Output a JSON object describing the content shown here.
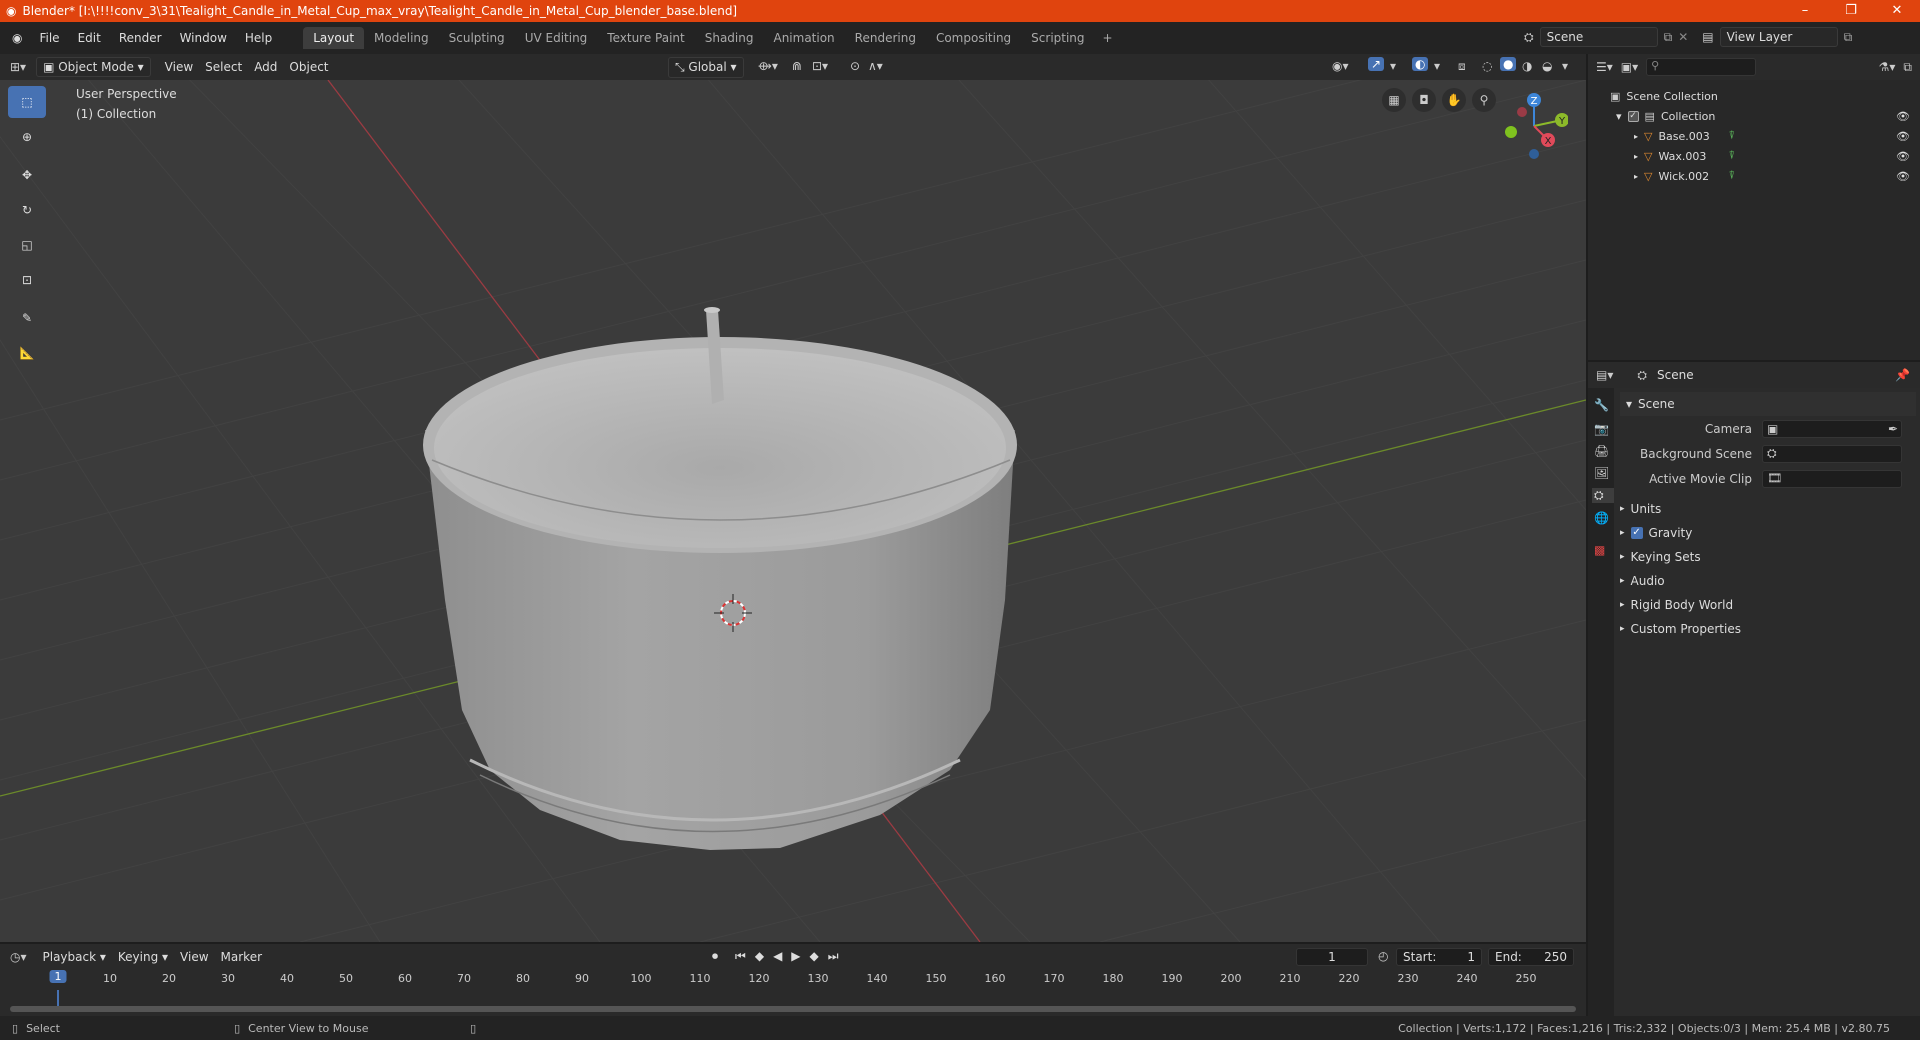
{
  "window": {
    "title": "Blender* [I:\\!!!!conv_3\\31\\Tealight_Candle_in_Metal_Cup_max_vray\\Tealight_Candle_in_Metal_Cup_blender_base.blend]"
  },
  "menu": {
    "items": [
      "File",
      "Edit",
      "Render",
      "Window",
      "Help"
    ]
  },
  "workspaces": {
    "tabs": [
      "Layout",
      "Modeling",
      "Sculpting",
      "UV Editing",
      "Texture Paint",
      "Shading",
      "Animation",
      "Rendering",
      "Compositing",
      "Scripting"
    ]
  },
  "scene_selector": {
    "scene": "Scene",
    "view_layer": "View Layer"
  },
  "viewport_header": {
    "mode": "Object Mode",
    "view": "View",
    "select": "Select",
    "add": "Add",
    "object": "Object",
    "transform": "Global"
  },
  "viewport": {
    "perspective": "User Perspective",
    "collection": "(1) Collection"
  },
  "gizmo": {
    "z": "Z",
    "y": "Y",
    "x": "X"
  },
  "outliner": {
    "root": "Scene Collection",
    "collection": "Collection",
    "objects": [
      "Base.003",
      "Wax.003",
      "Wick.002"
    ]
  },
  "properties": {
    "header": "Scene",
    "panel": "Scene",
    "fields": {
      "camera": "Camera",
      "background_scene": "Background Scene",
      "active_movie_clip": "Active Movie Clip"
    },
    "sections": [
      "Units",
      "Gravity",
      "Keying Sets",
      "Audio",
      "Rigid Body World",
      "Custom Properties"
    ]
  },
  "timeline": {
    "menus": [
      "Playback",
      "Keying",
      "View",
      "Marker"
    ],
    "current_frame": "1",
    "start_label": "Start:",
    "start": "1",
    "end_label": "End:",
    "end": "250",
    "ruler": [
      "1",
      "10",
      "20",
      "30",
      "40",
      "50",
      "60",
      "70",
      "80",
      "90",
      "100",
      "110",
      "120",
      "130",
      "140",
      "150",
      "160",
      "170",
      "180",
      "190",
      "200",
      "210",
      "220",
      "230",
      "240",
      "250"
    ]
  },
  "statusbar": {
    "select": "Select",
    "center_view": "Center View to Mouse",
    "stats": "Collection | Verts:1,172 | Faces:1,216 | Tris:2,332 | Objects:0/3 | Mem: 25.4 MB | v2.80.75"
  },
  "colors": {
    "accent": "#4772b3",
    "titlebar": "#e0440e",
    "x_axis": "#e04a5a",
    "y_axis": "#8cba2a",
    "z_axis": "#3d86d9"
  }
}
